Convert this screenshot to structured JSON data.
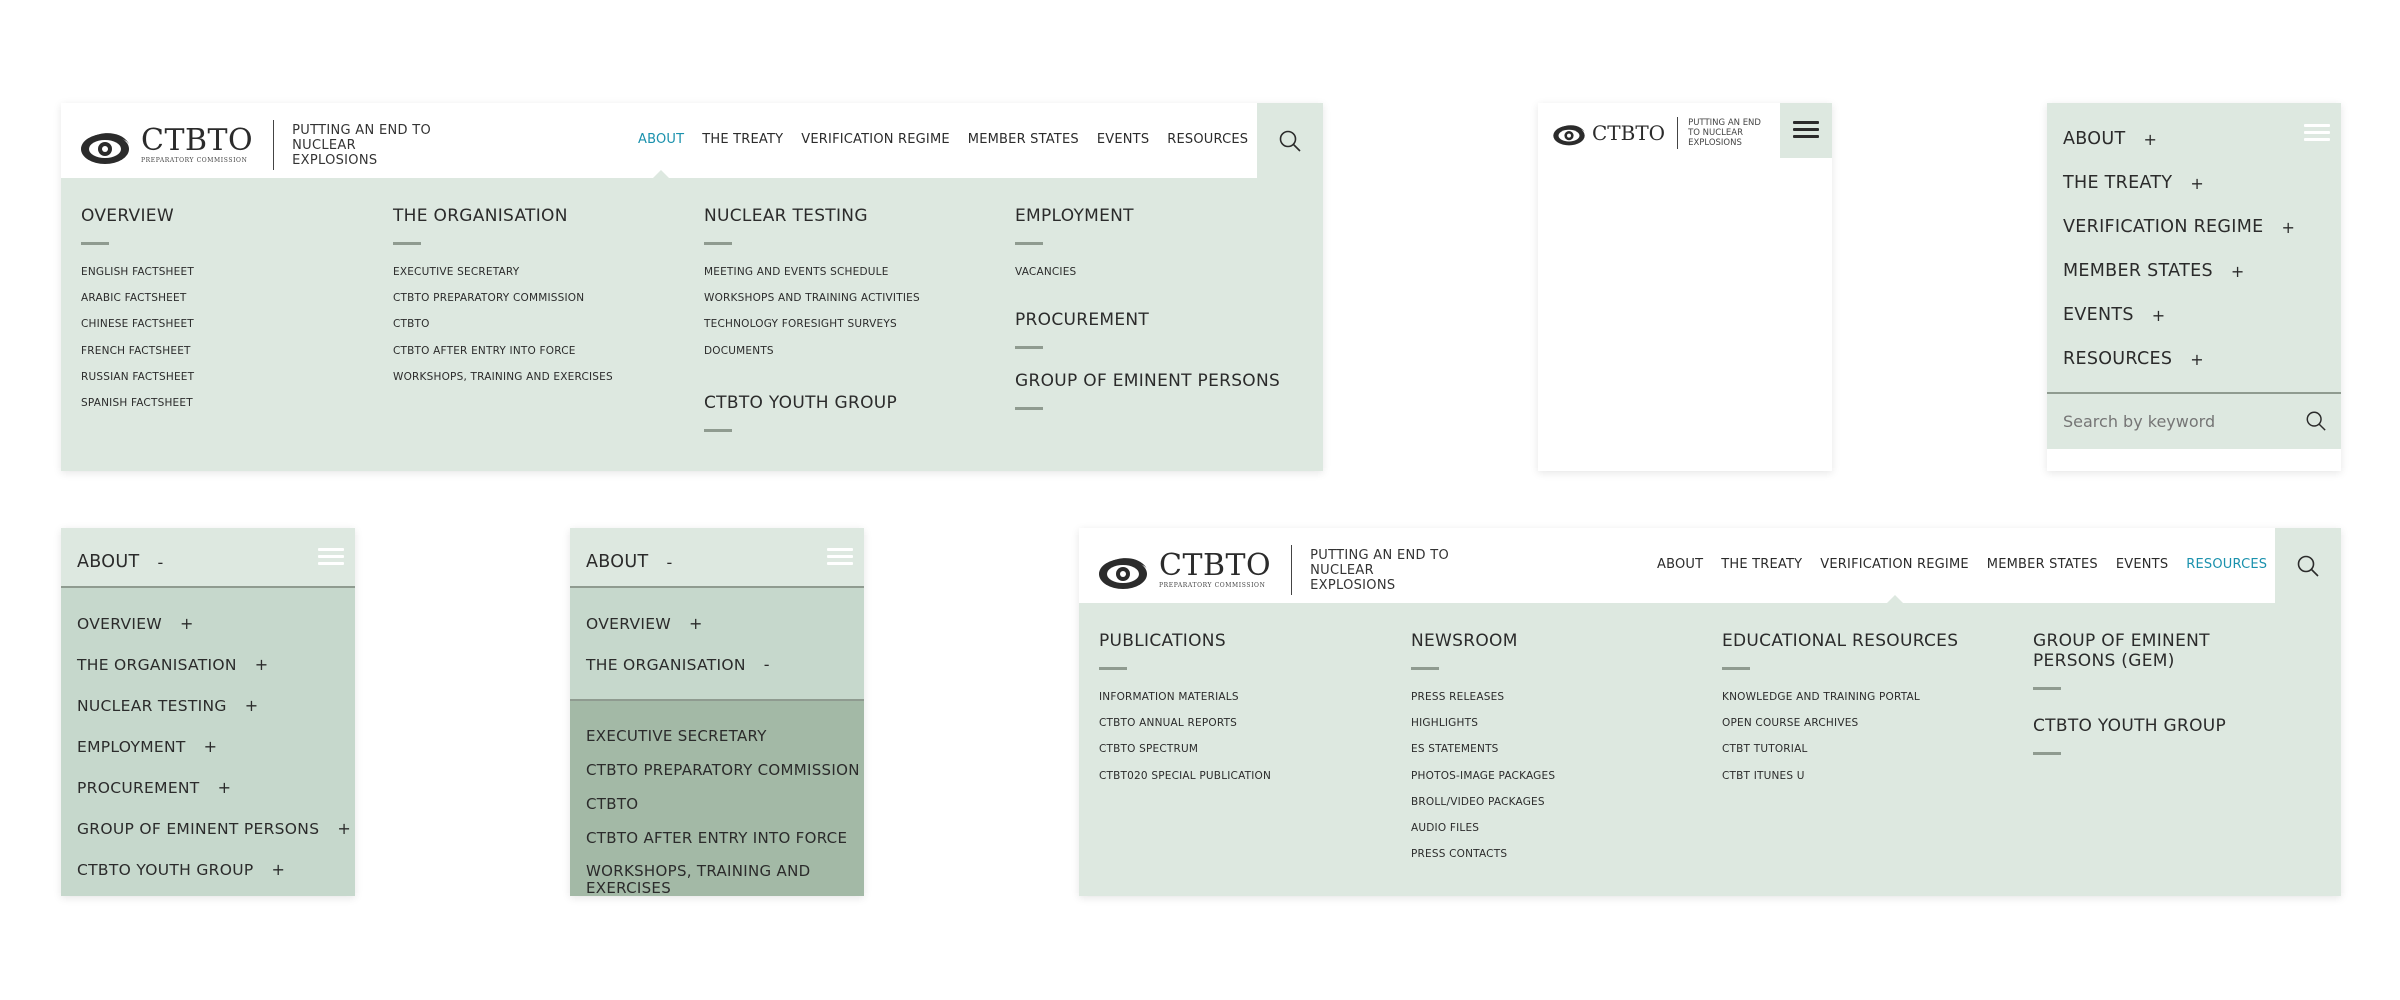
{
  "logo": {
    "word": "CTBTO",
    "sub": "PREPARATORY COMMISSION",
    "tagline": "PUTTING AN END TO NUCLEAR EXPLOSIONS"
  },
  "topnav": [
    "ABOUT",
    "THE TREATY",
    "VERIFICATION REGIME",
    "MEMBER STATES",
    "EVENTS",
    "RESOURCES"
  ],
  "colors": {
    "accent": "#1a91ad",
    "mint": "#dde8e0",
    "mint_dark": "#c6d8cc",
    "sage": "#a3b9a6",
    "divider": "#8f9b90"
  },
  "about_menu": {
    "active": "ABOUT",
    "columns": [
      {
        "sections": [
          {
            "heading": "OVERVIEW",
            "links": [
              "ENGLISH FACTSHEET",
              "ARABIC FACTSHEET",
              "CHINESE FACTSHEET",
              "FRENCH FACTSHEET",
              "RUSSIAN FACTSHEET",
              "SPANISH FACTSHEET"
            ]
          }
        ]
      },
      {
        "sections": [
          {
            "heading": "THE ORGANISATION",
            "links": [
              "EXECUTIVE SECRETARY",
              "CTBTO PREPARATORY COMMISSION",
              "CTBTO",
              "CTBTO AFTER ENTRY INTO FORCE",
              "WORKSHOPS, TRAINING AND EXERCISES"
            ]
          }
        ]
      },
      {
        "sections": [
          {
            "heading": "NUCLEAR TESTING",
            "links": [
              "MEETING AND EVENTS SCHEDULE",
              "WORKSHOPS AND TRAINING ACTIVITIES",
              "TECHNOLOGY FORESIGHT SURVEYS",
              "DOCUMENTS"
            ]
          },
          {
            "heading": "CTBTO YOUTH GROUP",
            "links": []
          }
        ]
      },
      {
        "sections": [
          {
            "heading": "EMPLOYMENT",
            "links": [
              "VACANCIES"
            ]
          },
          {
            "heading": "PROCUREMENT",
            "links": []
          },
          {
            "heading": "GROUP OF EMINENT PERSONS",
            "links": []
          }
        ]
      }
    ]
  },
  "resources_menu": {
    "active": "RESOURCES",
    "columns": [
      {
        "heading": "PUBLICATIONS",
        "links": [
          "INFORMATION MATERIALS",
          "CTBTO ANNUAL REPORTS",
          "CTBTO SPECTRUM",
          "CTBT020 SPECIAL PUBLICATION"
        ]
      },
      {
        "heading": "NEWSROOM",
        "links": [
          "PRESS RELEASES",
          "HIGHLIGHTS",
          "ES STATEMENTS",
          "PHOTOS-IMAGE PACKAGES",
          "BROLL/VIDEO PACKAGES",
          "AUDIO FILES",
          "PRESS CONTACTS"
        ]
      },
      {
        "heading": "EDUCATIONAL RESOURCES",
        "links": [
          "KNOWLEDGE AND TRAINING PORTAL",
          "OPEN COURSE ARCHIVES",
          "CTBT TUTORIAL",
          "CTBT ITUNES U"
        ]
      },
      {
        "heading": "GROUP OF EMINENT PERSONS (GEM)",
        "links": [],
        "extra": "CTBTO YOUTH GROUP"
      }
    ]
  },
  "mobile_menu": {
    "items": [
      "ABOUT",
      "THE TREATY",
      "VERIFICATION REGIME",
      "MEMBER STATES",
      "EVENTS",
      "RESOURCES"
    ],
    "plus": "+",
    "minus": "-",
    "search_placeholder": "Search by keyword"
  },
  "mobile_about": {
    "title": "ABOUT",
    "items": [
      "OVERVIEW",
      "THE ORGANISATION",
      "NUCLEAR TESTING",
      "EMPLOYMENT",
      "PROCUREMENT",
      "GROUP OF EMINENT PERSONS",
      "CTBTO YOUTH GROUP"
    ]
  },
  "mobile_org": {
    "title": "ABOUT",
    "items": [
      "OVERVIEW",
      "THE ORGANISATION"
    ],
    "sub": [
      "EXECUTIVE SECRETARY",
      "CTBTO PREPARATORY COMMISSION",
      "CTBTO",
      "CTBTO AFTER ENTRY INTO FORCE",
      "WORKSHOPS, TRAINING AND EXERCISES"
    ]
  }
}
